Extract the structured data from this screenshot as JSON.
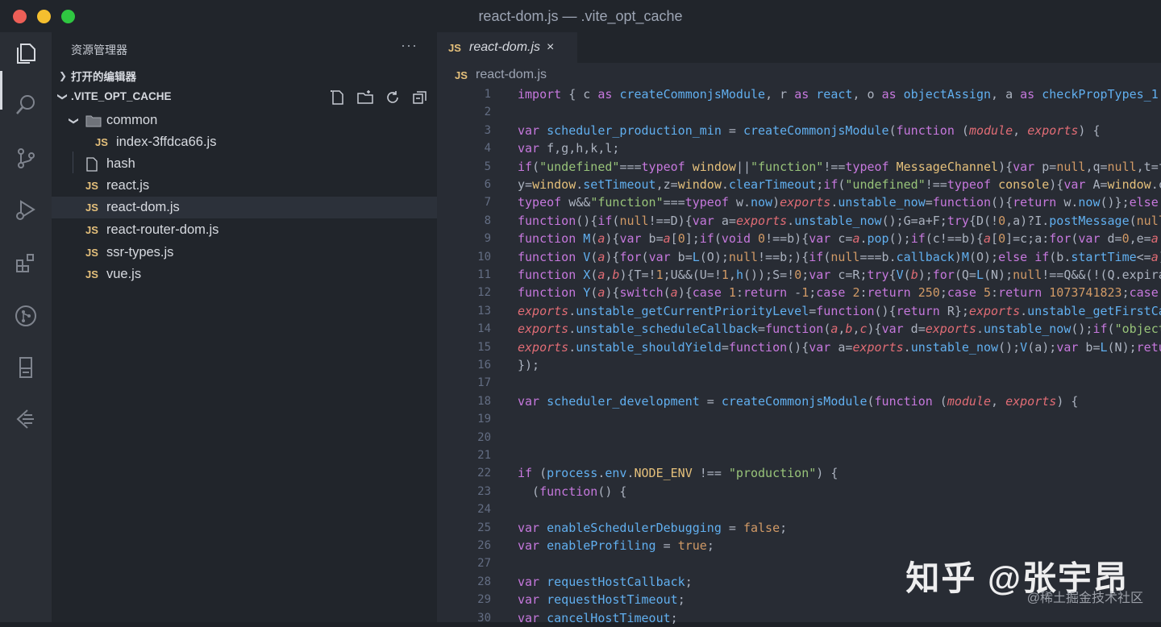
{
  "window": {
    "title": "react-dom.js — .vite_opt_cache"
  },
  "activity_bar": {
    "icons": [
      "files-icon",
      "search-icon",
      "source-control-icon",
      "run-debug-icon",
      "extensions-icon",
      "git-graph-icon",
      "remote-explorer-icon",
      "live-share-icon"
    ]
  },
  "sidebar": {
    "title": "资源管理器",
    "more": "···",
    "open_editors": "打开的编辑器",
    "folder": ".VITE_OPT_CACHE",
    "tree": [
      {
        "label": "common",
        "type": "folder"
      },
      {
        "label": "index-3ffdca66.js",
        "type": "js"
      },
      {
        "label": "hash",
        "type": "file"
      },
      {
        "label": "react.js",
        "type": "js"
      },
      {
        "label": "react-dom.js",
        "type": "js"
      },
      {
        "label": "react-router-dom.js",
        "type": "js"
      },
      {
        "label": "ssr-types.js",
        "type": "js"
      },
      {
        "label": "vue.js",
        "type": "js"
      }
    ]
  },
  "editor": {
    "tab": {
      "badge": "JS",
      "label": "react-dom.js",
      "close": "×"
    },
    "breadcrumb": {
      "badge": "JS",
      "label": "react-dom.js"
    },
    "line_numbers": [
      "1",
      "2",
      "3",
      "4",
      "5",
      "6",
      "7",
      "8",
      "9",
      "10",
      "11",
      "12",
      "13",
      "14",
      "15",
      "16",
      "17",
      "18",
      "19",
      "20",
      "21",
      "22",
      "23",
      "24",
      "25",
      "26",
      "27",
      "28",
      "29",
      "30"
    ]
  },
  "watermark": {
    "main": "知乎 @张宇昂",
    "sub": "@稀土掘金技术社区"
  },
  "colors": {
    "keyword": "#c678dd",
    "function": "#61afef",
    "string": "#98c379",
    "number": "#d19a66",
    "param": "#e06c75",
    "accent": "#e5c07b"
  }
}
